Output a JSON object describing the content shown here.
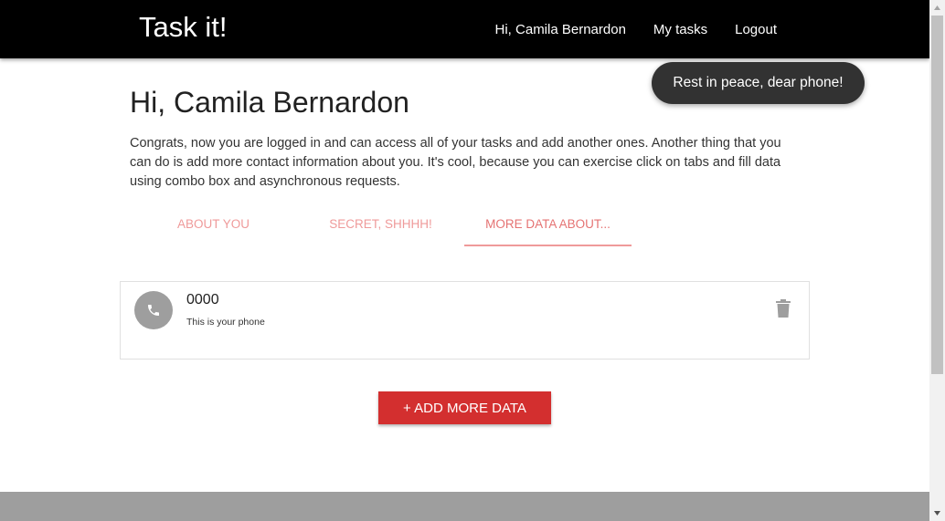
{
  "navbar": {
    "brand": "Task it!",
    "greeting": "Hi, Camila Bernardon",
    "my_tasks": "My tasks",
    "logout": "Logout"
  },
  "main": {
    "title": "Hi, Camila Bernardon",
    "intro": "Congrats, now you are logged in and can access all of your tasks and add another ones. Another thing that you can do is add more contact information about you. It's cool, because you can exercise click on tabs and fill data using combo box and asynchronous requests.",
    "tabs": [
      {
        "label": "About you",
        "active": false
      },
      {
        "label": "Secret, shhhh!",
        "active": false
      },
      {
        "label": "More data about...",
        "active": true
      }
    ],
    "contact_items": [
      {
        "icon": "phone-icon",
        "value": "0000",
        "description": "This is your phone"
      }
    ],
    "add_button": "+ Add more data"
  },
  "toast": {
    "message": "Rest in peace, dear phone!"
  },
  "colors": {
    "navbar_bg": "#000000",
    "accent": "#d32f2f",
    "tab_text": "#ef9a9a",
    "avatar_bg": "#9e9e9e",
    "toast_bg": "#323232",
    "footer_bg": "#9e9e9e"
  }
}
